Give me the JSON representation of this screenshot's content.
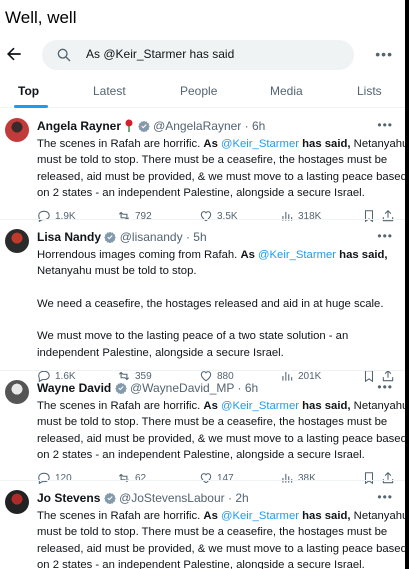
{
  "caption": "Well, well",
  "search": {
    "query": "As @Keir_Starmer has said"
  },
  "tabs": [
    "Top",
    "Latest",
    "People",
    "Media",
    "Lists"
  ],
  "tweets": [
    {
      "name": "Angela Rayner",
      "handle": "@AngelaRayner",
      "time": "· 6h",
      "rose": true,
      "lines": [
        [
          {
            "t": "The scenes in Rafah are horrific. "
          },
          {
            "t": "As ",
            "b": true
          },
          {
            "t": "@Keir_Starmer",
            "m": true
          },
          {
            "t": " has said,",
            "b": true
          },
          {
            "t": " Netanyahu"
          }
        ],
        [
          {
            "t": "must be told to stop. There must be a ceasefire, the hostages must be"
          }
        ],
        [
          {
            "t": "released, aid must be provided, & we must move to a lasting peace based"
          }
        ],
        [
          {
            "t": "on 2 states - an independent Palestine, alongside a secure Israel."
          }
        ]
      ],
      "replies": "1.9K",
      "reposts": "792",
      "likes": "3.5K",
      "views": "318K"
    },
    {
      "name": "Lisa Nandy",
      "handle": "@lisanandy",
      "time": "· 5h",
      "rose": false,
      "lines": [
        [
          {
            "t": "Horrendous images coming from Rafah. "
          },
          {
            "t": "As ",
            "b": true
          },
          {
            "t": "@Keir_Starmer",
            "m": true
          },
          {
            "t": " has said,",
            "b": true
          }
        ],
        [
          {
            "t": "Netanyahu must be told to stop."
          }
        ],
        [],
        [
          {
            "t": "We need a ceasefire, the hostages released and aid in at huge scale."
          }
        ],
        [],
        [
          {
            "t": "We must move to the lasting peace of a two state solution - an"
          }
        ],
        [
          {
            "t": "independent Palestine, alongside a secure Israel."
          }
        ]
      ],
      "replies": "1.6K",
      "reposts": "359",
      "likes": "880",
      "views": "201K"
    },
    {
      "name": "Wayne David",
      "handle": "@WayneDavid_MP",
      "time": "· 6h",
      "rose": false,
      "lines": [
        [
          {
            "t": "The scenes in Rafah are horrific. "
          },
          {
            "t": "As ",
            "b": true
          },
          {
            "t": "@Keir_Starmer",
            "m": true
          },
          {
            "t": " has said,",
            "b": true
          },
          {
            "t": " Netanyahu"
          }
        ],
        [
          {
            "t": "must be told to stop. There must be a ceasefire, the hostages must be"
          }
        ],
        [
          {
            "t": "released, aid must be provided, & we must move to a lasting peace based"
          }
        ],
        [
          {
            "t": "on 2 states - an independent Palestine, alongside a secure Israel."
          }
        ]
      ],
      "replies": "120",
      "reposts": "62",
      "likes": "147",
      "views": "38K"
    },
    {
      "name": "Jo Stevens",
      "handle": "@JoStevensLabour",
      "time": "· 2h",
      "rose": false,
      "lines": [
        [
          {
            "t": "The scenes in Rafah are horrific. "
          },
          {
            "t": "As ",
            "b": true
          },
          {
            "t": "@Keir_Starmer",
            "m": true
          },
          {
            "t": " has said,",
            "b": true
          },
          {
            "t": " Netanyahu"
          }
        ],
        [
          {
            "t": "must be told to stop. There must be a ceasefire, the hostages must be"
          }
        ],
        [
          {
            "t": "released, aid must be provided, & we must move to a lasting peace based"
          }
        ],
        [
          {
            "t": "on 2 states - an independent Palestine, alongside a secure Israel."
          }
        ]
      ],
      "replies": "",
      "reposts": "",
      "likes": "",
      "views": ""
    }
  ]
}
